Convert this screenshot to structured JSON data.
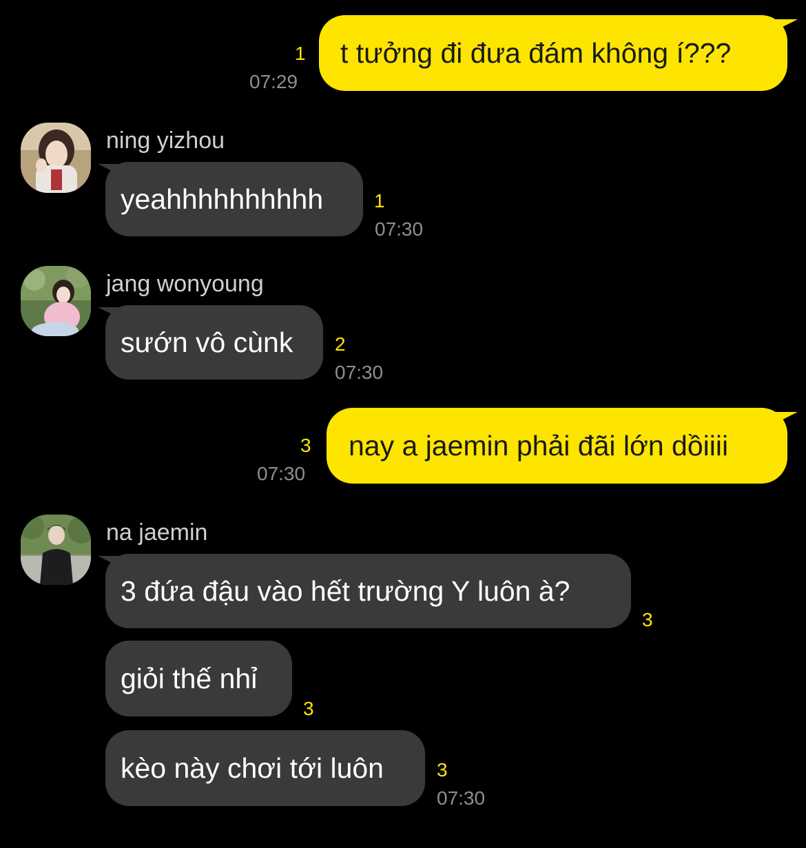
{
  "chat": {
    "messages": [
      {
        "id": "m1",
        "direction": "outgoing",
        "text": "t tưởng đi đưa đám không í???",
        "unread": "1",
        "time": "07:29"
      },
      {
        "id": "m2",
        "direction": "incoming",
        "sender": "ning yizhou",
        "text": "yeahhhhhhhhhh",
        "unread": "1",
        "time": "07:30"
      },
      {
        "id": "m3",
        "direction": "incoming",
        "sender": "jang wonyoung",
        "text": "sướn vô cùnk",
        "unread": "2",
        "time": "07:30"
      },
      {
        "id": "m4",
        "direction": "outgoing",
        "text": "nay a jaemin phải đãi lớn dồiiii",
        "unread": "3",
        "time": "07:30"
      },
      {
        "id": "m5",
        "direction": "incoming",
        "sender": "na jaemin",
        "text": "3 đứa đậu vào hết trường Y luôn à?",
        "unread": "3"
      },
      {
        "id": "m6",
        "direction": "incoming",
        "text": "giỏi thế nhỉ",
        "unread": "3"
      },
      {
        "id": "m7",
        "direction": "incoming",
        "text": "kèo này chơi tới luôn",
        "unread": "3",
        "time": "07:30"
      }
    ]
  },
  "colors": {
    "background": "#000000",
    "outgoing_bubble": "#FEE500",
    "incoming_bubble": "#3a3a3c",
    "unread_count": "#FEE500",
    "timestamp": "#8e8e93"
  }
}
